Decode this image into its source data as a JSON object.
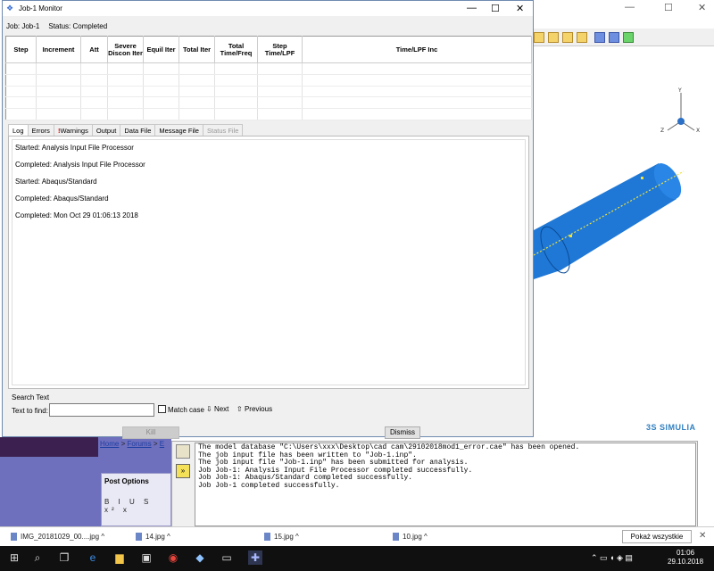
{
  "monitor": {
    "title": "Job-1 Monitor",
    "job_label": "Job:",
    "job_value": "Job-1",
    "status_label": "Status:",
    "status_value": "Completed",
    "controls": {
      "minimize": "—",
      "maximize": "☐",
      "close": "✕"
    }
  },
  "table": {
    "columns": [
      "Step",
      "Increment",
      "Att",
      "Severe Discon Iter",
      "Equil Iter",
      "Total Iter",
      "Total Time/Freq",
      "Step Time/LPF",
      "Time/LPF Inc"
    ],
    "rows": []
  },
  "tabs": [
    {
      "label": "Log",
      "state": "active"
    },
    {
      "label": "Errors",
      "state": "normal"
    },
    {
      "label": "Warnings",
      "state": "normal",
      "prefix": "!"
    },
    {
      "label": "Output",
      "state": "normal"
    },
    {
      "label": "Data File",
      "state": "normal"
    },
    {
      "label": "Message File",
      "state": "normal"
    },
    {
      "label": "Status File",
      "state": "disabled"
    }
  ],
  "log": [
    "Started:   Analysis Input File Processor",
    "Completed: Analysis Input File Processor",
    "Started:   Abaqus/Standard",
    "Completed: Abaqus/Standard",
    "Completed: Mon Oct 29 01:06:13 2018"
  ],
  "search": {
    "group_title": "Search Text",
    "text_to_find_label": "Text to find:",
    "value": "",
    "match_case_label": "Match case",
    "match_case": false,
    "next_label": "Next",
    "previous_label": "Previous"
  },
  "buttons": {
    "kill": "Kill",
    "dismiss": "Dismiss"
  },
  "background": {
    "simulia": "3S SIMULIA",
    "breadcrumb": {
      "home": "Home",
      "sep": ">",
      "forums": "Forums",
      "next": "E"
    },
    "post_options": "Post Options",
    "format_buttons": "B I U S x² x"
  },
  "messages": [
    "The model database \"C:\\Users\\xxx\\Desktop\\cad cam\\29102018mod1_error.cae\" has been opened.",
    "The job input file has been written to \"Job-1.inp\".",
    "The job input file \"Job-1.inp\" has been submitted for analysis.",
    "Job Job-1: Analysis Input File Processor completed successfully.",
    "Job Job-1: Abaqus/Standard completed successfully.",
    "Job Job-1 completed successfully."
  ],
  "downloads": {
    "items": [
      "IMG_20181029_00....jpg",
      "14.jpg",
      "15.jpg",
      "10.jpg"
    ],
    "show_all": "Pokaż wszystkie",
    "close": "✕"
  },
  "taskbar": {
    "time": "01:06",
    "date": "29.10.2018"
  },
  "colors": {
    "tube": "#1f78d6",
    "title_accent": "#3a6fd6",
    "taskbar": "#101010"
  }
}
